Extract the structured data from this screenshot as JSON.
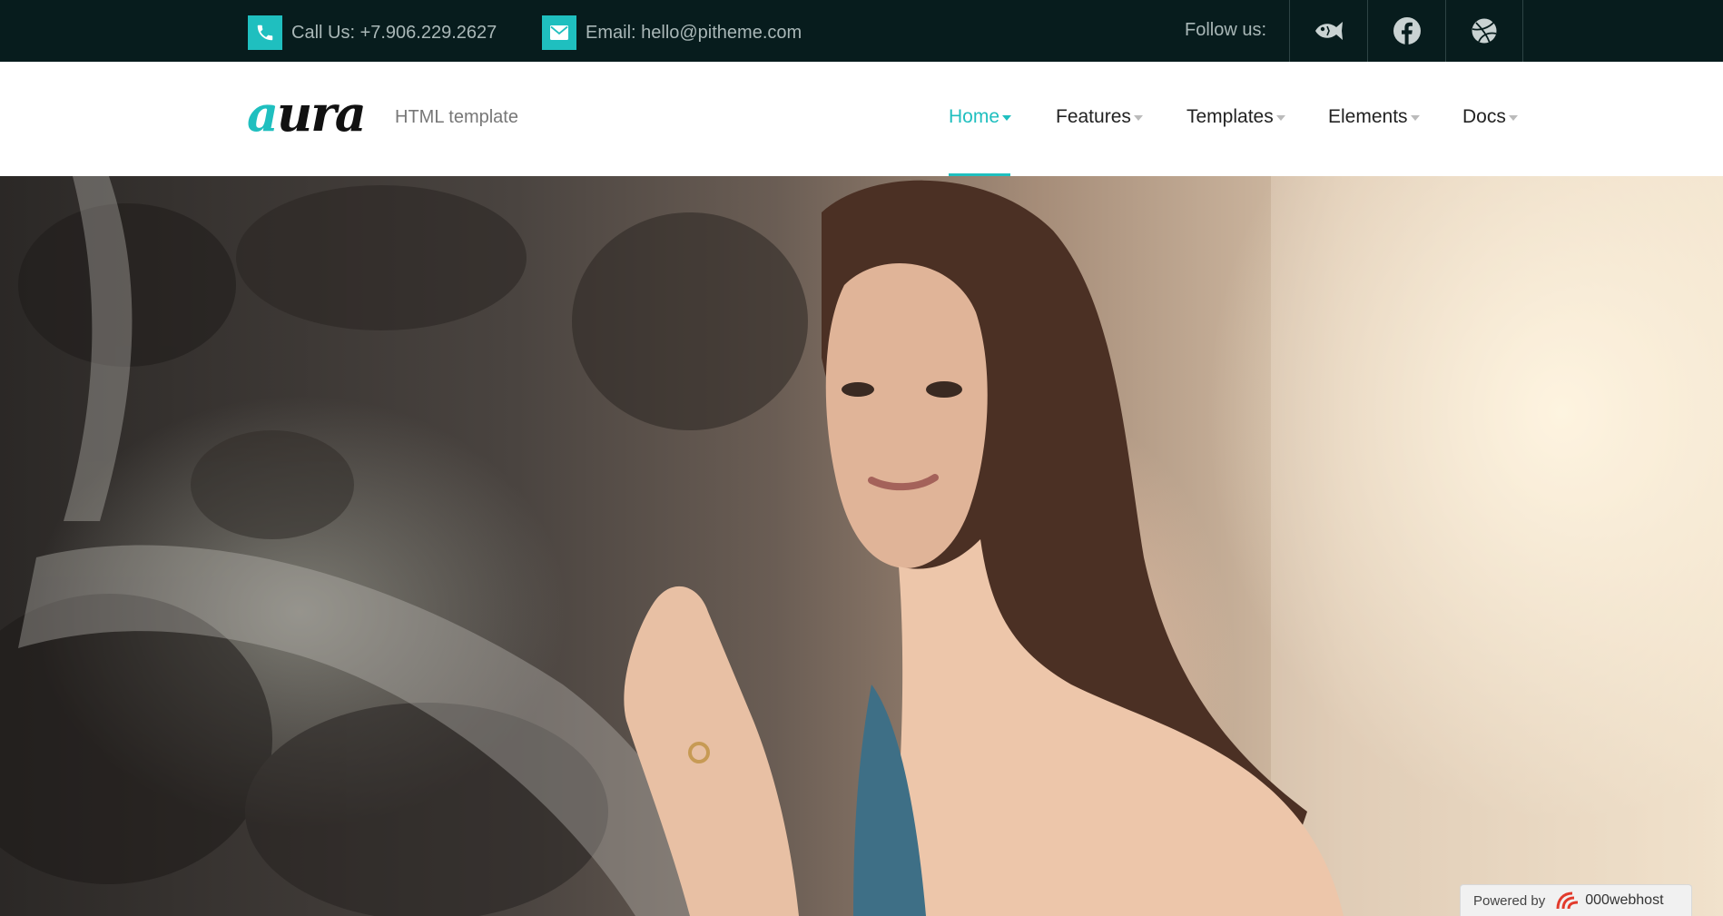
{
  "topbar": {
    "phone_text": "Call Us: +7.906.229.2627",
    "phone_icon": "phone-icon",
    "email_text": "Email: hello@pitheme.com",
    "email_icon": "envelope-icon",
    "follow_label": "Follow us:",
    "social": [
      "flickr-fish-icon",
      "facebook-icon",
      "dribbble-icon"
    ]
  },
  "header": {
    "logo_accent": "a",
    "logo_rest": "ura",
    "tagline": "HTML template",
    "nav": [
      {
        "label": "Home",
        "active": true
      },
      {
        "label": "Features",
        "active": false
      },
      {
        "label": "Templates",
        "active": false
      },
      {
        "label": "Elements",
        "active": false
      },
      {
        "label": "Docs",
        "active": false
      }
    ]
  },
  "hero": {
    "image": "woman-leaning-against-rock-wall"
  },
  "badge": {
    "prefix": "Powered by",
    "brand": "000webhost"
  },
  "colors": {
    "topbar_bg": "#071c1d",
    "accent": "#1fbfbf",
    "nav_text": "#222222",
    "muted_text": "#a9b7b7"
  }
}
